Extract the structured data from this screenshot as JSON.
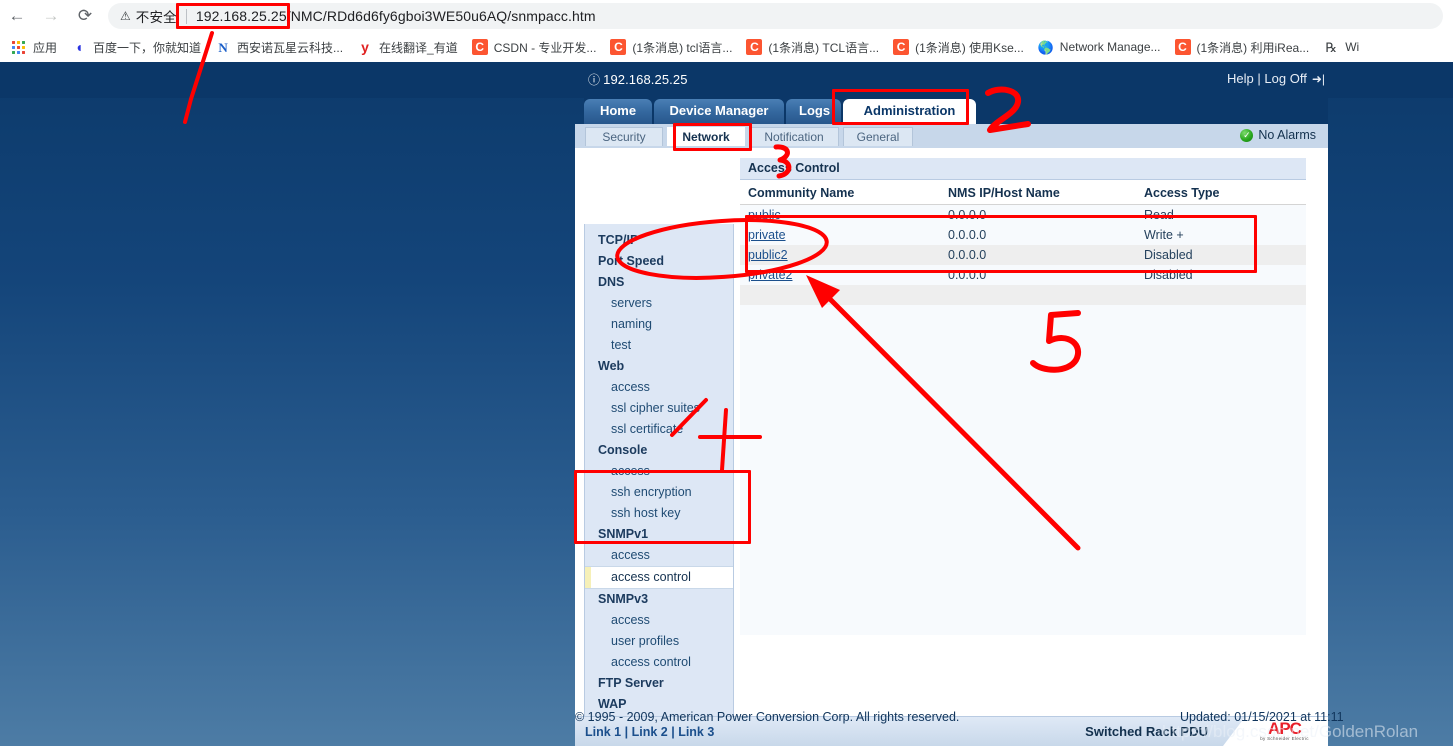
{
  "browser": {
    "nav": {
      "back_icon": "back-arrow-icon",
      "forward_icon": "forward-arrow-icon",
      "reload_icon": "reload-icon"
    },
    "omnibox": {
      "warn_icon": "not-secure-warning-icon",
      "security_label": "不安全",
      "url_host": "192.168.25.25/",
      "url_path": "NMC/RDd6d6fy6gboi3WE50u6AQ/snmpacc.htm",
      "full_url": "192.168.25.25/NMC/RDd6d6fy6gboi3WE50u6AQ/snmpacc.htm"
    },
    "bookmarks": [
      {
        "label": "应用",
        "icon": "apps-grid-icon"
      },
      {
        "label": "百度一下，你就知道",
        "icon": "baidu-icon"
      },
      {
        "label": "西安诺瓦星云科技...",
        "icon": "nova-icon"
      },
      {
        "label": "在线翻译_有道",
        "icon": "youdao-icon"
      },
      {
        "label": "CSDN - 专业开发...",
        "icon": "csdn-icon"
      },
      {
        "label": "(1条消息) tcl语言...",
        "icon": "csdn-icon"
      },
      {
        "label": "(1条消息) TCL语言...",
        "icon": "csdn-icon"
      },
      {
        "label": "(1条消息) 使用Kse...",
        "icon": "csdn-icon"
      },
      {
        "label": "Network Manage...",
        "icon": "globe-icon"
      },
      {
        "label": "(1条消息) 利用iRea...",
        "icon": "csdn-icon"
      },
      {
        "label": "Wi",
        "icon": "wireshark-icon"
      }
    ]
  },
  "apc": {
    "device_ip": "192.168.25.25",
    "info_icon": "info-circle-icon",
    "help_label": "Help",
    "separator": "|",
    "logoff_label": "Log Off",
    "logoff_icon": "log-off-icon",
    "main_tabs": [
      {
        "label": "Home",
        "active": false
      },
      {
        "label": "Device Manager",
        "active": false
      },
      {
        "label": "Logs",
        "active": false
      },
      {
        "label": "Administration",
        "active": true
      }
    ],
    "sub_tabs": [
      {
        "label": "Security",
        "active": false
      },
      {
        "label": "Network",
        "active": true
      },
      {
        "label": "Notification",
        "active": false
      },
      {
        "label": "General",
        "active": false
      }
    ],
    "alarm": {
      "icon": "green-check-icon",
      "label": "No Alarms"
    },
    "sidebar": [
      {
        "label": "TCP/IP",
        "type": "group",
        "selected": false
      },
      {
        "label": "Port Speed",
        "type": "group",
        "selected": false
      },
      {
        "label": "DNS",
        "type": "group",
        "selected": false
      },
      {
        "label": "servers",
        "type": "item",
        "selected": false
      },
      {
        "label": "naming",
        "type": "item",
        "selected": false
      },
      {
        "label": "test",
        "type": "item",
        "selected": false
      },
      {
        "label": "Web",
        "type": "group",
        "selected": false
      },
      {
        "label": "access",
        "type": "item",
        "selected": false
      },
      {
        "label": "ssl cipher suites",
        "type": "item",
        "selected": false
      },
      {
        "label": "ssl certificate",
        "type": "item",
        "selected": false
      },
      {
        "label": "Console",
        "type": "group",
        "selected": false
      },
      {
        "label": "access",
        "type": "item",
        "selected": false
      },
      {
        "label": "ssh encryption",
        "type": "item",
        "selected": false
      },
      {
        "label": "ssh host key",
        "type": "item",
        "selected": false
      },
      {
        "label": "SNMPv1",
        "type": "group",
        "selected": false
      },
      {
        "label": "access",
        "type": "item",
        "selected": false
      },
      {
        "label": "access control",
        "type": "item",
        "selected": true
      },
      {
        "label": "SNMPv3",
        "type": "group",
        "selected": false
      },
      {
        "label": "access",
        "type": "item",
        "selected": false
      },
      {
        "label": "user profiles",
        "type": "item",
        "selected": false
      },
      {
        "label": "access control",
        "type": "item",
        "selected": false
      },
      {
        "label": "FTP Server",
        "type": "group",
        "selected": false
      },
      {
        "label": "WAP",
        "type": "group",
        "selected": false
      }
    ],
    "section_title": "Access Control",
    "table": {
      "columns": [
        "Community Name",
        "NMS IP/Host Name",
        "Access Type"
      ],
      "rows": [
        {
          "community": "public",
          "nms": "0.0.0.0",
          "access": "Read"
        },
        {
          "community": "private",
          "nms": "0.0.0.0",
          "access": "Write +"
        },
        {
          "community": "public2",
          "nms": "0.0.0.0",
          "access": "Disabled"
        },
        {
          "community": "private2",
          "nms": "0.0.0.0",
          "access": "Disabled"
        }
      ]
    },
    "footer": {
      "links": [
        "Link 1",
        "Link 2",
        "Link 3"
      ],
      "link_separator": "|",
      "model": "Switched Rack PDU",
      "logo_text": "APC",
      "logo_sub": "by Schneider Electric"
    },
    "copyright": "© 1995 - 2009, American Power Conversion Corp. All rights reserved.",
    "updated": "Updated: 01/15/2021 at 11:11",
    "watermark": "https://blog.csdn.net/GoldenRolan"
  },
  "annotations": {
    "accent_color": "#ff0000",
    "marks": [
      {
        "name": "url-highlight-box",
        "kind": "box"
      },
      {
        "name": "administration-tab-box",
        "kind": "box"
      },
      {
        "name": "network-tab-box",
        "kind": "box"
      },
      {
        "name": "snmpv1-group-box",
        "kind": "box"
      },
      {
        "name": "table-rows-box",
        "kind": "box"
      },
      {
        "name": "community-name-ellipse",
        "kind": "ellipse"
      },
      {
        "name": "callout-number-2",
        "kind": "digit",
        "text": "2"
      },
      {
        "name": "callout-number-3",
        "kind": "digit",
        "text": "3"
      },
      {
        "name": "callout-number-5",
        "kind": "digit",
        "text": "5"
      },
      {
        "name": "arrow-to-url",
        "kind": "arrow"
      },
      {
        "name": "arrow-to-snmpv1",
        "kind": "arrow"
      },
      {
        "name": "arrow-to-table",
        "kind": "arrow"
      }
    ]
  }
}
